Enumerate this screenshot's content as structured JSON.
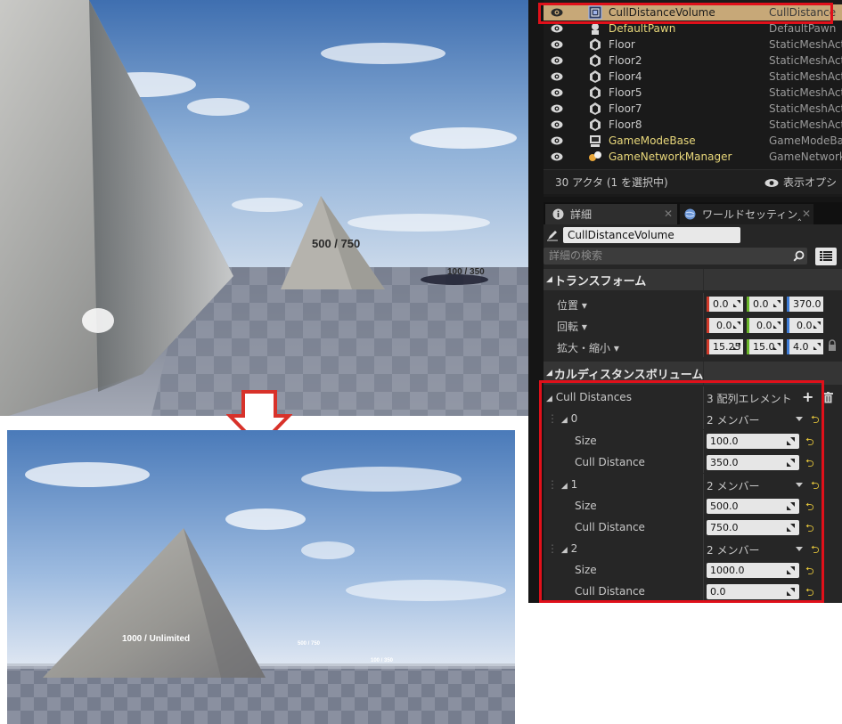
{
  "scene_before": {
    "label_mid": "500 / 750",
    "label_far": "100 / 350"
  },
  "scene_after": {
    "label_near": "1000 / Unlimited",
    "label_mid": "500 / 750",
    "label_far": "100 / 350"
  },
  "outliner": {
    "rows": [
      {
        "name": "CullDistanceVolume",
        "type": "CullDistance",
        "icon": "cull-volume-icon",
        "selected": true
      },
      {
        "name": "DefaultPawn",
        "type": "DefaultPawn",
        "icon": "pawn-icon"
      },
      {
        "name": "Floor",
        "type": "StaticMeshActo",
        "icon": "static-mesh-icon"
      },
      {
        "name": "Floor2",
        "type": "StaticMeshActo",
        "icon": "static-mesh-icon"
      },
      {
        "name": "Floor4",
        "type": "StaticMeshActo",
        "icon": "static-mesh-icon"
      },
      {
        "name": "Floor5",
        "type": "StaticMeshActo",
        "icon": "static-mesh-icon"
      },
      {
        "name": "Floor7",
        "type": "StaticMeshActo",
        "icon": "static-mesh-icon"
      },
      {
        "name": "Floor8",
        "type": "StaticMeshActo",
        "icon": "static-mesh-icon"
      },
      {
        "name": "GameModeBase",
        "type": "GameModeBas",
        "icon": "game-mode-icon"
      },
      {
        "name": "GameNetworkManager",
        "type": "GameNetworkM",
        "icon": "network-manager-icon"
      }
    ],
    "actor_count": "30 アクタ (1 を選択中)",
    "view_options": "表示オプシ"
  },
  "tabs": {
    "details": "詳細",
    "world_settings": "ワールドセッティン‸"
  },
  "details": {
    "actor_name": "CullDistanceVolume",
    "search_placeholder": "詳細の検索",
    "transform": {
      "header": "トランスフォーム",
      "location_label": "位置",
      "rotation_label": "回転",
      "scale_label": "拡大・縮小",
      "location": [
        "0.0",
        "0.0",
        "370.0"
      ],
      "rotation": [
        "0.0",
        "0.0",
        "0.0"
      ],
      "scale": [
        "15.25",
        "15.0",
        "4.0"
      ]
    },
    "cull_section": {
      "header": "カルディスタンスボリューム",
      "array_label": "Cull Distances",
      "array_count": "3 配列エレメント",
      "members_text": "2 メンバー",
      "size_label": "Size",
      "cull_label": "Cull Distance",
      "elements": [
        {
          "index": "0",
          "size": "100.0",
          "cull": "350.0"
        },
        {
          "index": "1",
          "size": "500.0",
          "cull": "750.0"
        },
        {
          "index": "2",
          "size": "1000.0",
          "cull": "0.0"
        }
      ]
    }
  },
  "colors": {
    "highlight_box": "#e0101a",
    "selected_row": "#c7a878"
  }
}
